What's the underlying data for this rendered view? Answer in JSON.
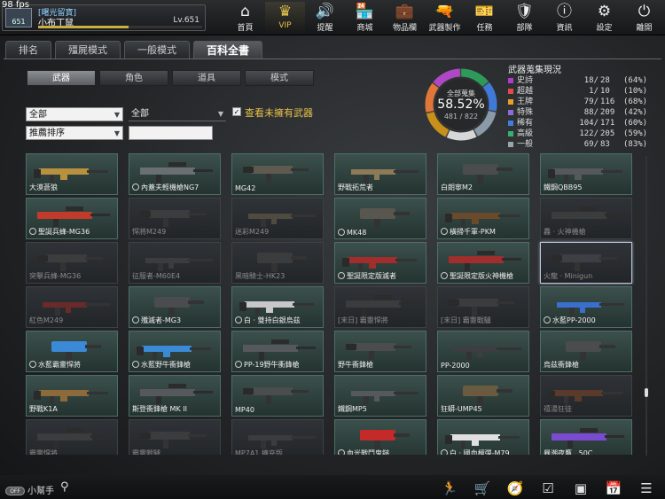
{
  "fps": "98 fps",
  "player": {
    "clan": "[曙光留寶]",
    "name": "小布丁鼠",
    "level": "Lv.651",
    "rank": "651",
    "exp_progress": 0.55
  },
  "nav": [
    {
      "label": "首頁",
      "icon": "home-icon",
      "glyph": "⌂"
    },
    {
      "label": "VIP",
      "icon": "crown-icon",
      "glyph": "♛"
    },
    {
      "label": "提醒",
      "icon": "speaker-icon",
      "glyph": "🔊"
    },
    {
      "label": "商城",
      "icon": "shop-icon",
      "glyph": "🏪"
    },
    {
      "label": "物品欄",
      "icon": "bag-icon",
      "glyph": "💼"
    },
    {
      "label": "武器製作",
      "icon": "gun-icon",
      "glyph": "🔫"
    },
    {
      "label": "任務",
      "icon": "ticket-icon",
      "glyph": "🎫"
    },
    {
      "label": "部隊",
      "icon": "shield-icon",
      "glyph": "🛡"
    },
    {
      "label": "資訊",
      "icon": "info-icon",
      "glyph": "ⓘ"
    },
    {
      "label": "設定",
      "icon": "gear-icon",
      "glyph": "⚙"
    },
    {
      "label": "離開",
      "icon": "power-icon",
      "glyph": "⏻"
    }
  ],
  "main_tabs": [
    "排名",
    "殭屍模式",
    "一般模式",
    "百科全書"
  ],
  "sub_tabs": [
    "武器",
    "角色",
    "道具",
    "模式"
  ],
  "filters": {
    "category": "全部",
    "subcategory": "全部",
    "sort": "推薦排序",
    "search": "",
    "show_unowned_label": "查看未擁有武器",
    "show_unowned_checked": true
  },
  "collection": {
    "title": "全部蒐集",
    "percent": "58.52%",
    "count": "481 / 822",
    "fraction": 0.5852,
    "ring_colors": [
      "#2e9a5a",
      "#3f7bd6",
      "#8a9aa8",
      "#d7d7d7",
      "#c8901a",
      "#e0763a",
      "#b047c4"
    ]
  },
  "stats_title": "武器蒐集現況",
  "stats": [
    {
      "name": "史詩",
      "val": "18/",
      "max": "28",
      "pct": "(64%)",
      "color": "#b13ad0"
    },
    {
      "name": "超越",
      "val": "1/",
      "max": "10",
      "pct": "(10%)",
      "color": "#e24a4a"
    },
    {
      "name": "王牌",
      "val": "79/",
      "max": "116",
      "pct": "(68%)",
      "color": "#e7a12b"
    },
    {
      "name": "特殊",
      "val": "88/",
      "max": "209",
      "pct": "(42%)",
      "color": "#8b6dd8"
    },
    {
      "name": "稀有",
      "val": "104/",
      "max": "171",
      "pct": "(60%)",
      "color": "#3c7fe0"
    },
    {
      "name": "高級",
      "val": "122/",
      "max": "205",
      "pct": "(59%)",
      "color": "#38b06a"
    },
    {
      "name": "一般",
      "val": "69/",
      "max": "83",
      "pct": "(83%)",
      "color": "#9aa4ad"
    }
  ],
  "weapons": [
    {
      "name": "大漠蒼狼",
      "owned": true,
      "badge": false,
      "color": "#b8913f"
    },
    {
      "name": "內蓋夫輕機槍NG7",
      "owned": true,
      "badge": true,
      "color": "#6a6f72"
    },
    {
      "name": "MG42",
      "owned": true,
      "badge": false,
      "color": "#5f5a50"
    },
    {
      "name": "野戰拓荒者",
      "owned": true,
      "badge": false,
      "color": "#8d7a56"
    },
    {
      "name": "白朗寧M2",
      "owned": true,
      "badge": false,
      "color": "#4a4c4e"
    },
    {
      "name": "鐵鋼QBB95",
      "owned": true,
      "badge": false,
      "color": "#55595c"
    },
    {
      "name": "聖誕兵蜂-MG36",
      "owned": true,
      "badge": true,
      "color": "#c23a2a"
    },
    {
      "name": "悍將M249",
      "owned": false,
      "badge": false,
      "color": "#3a3c3e"
    },
    {
      "name": "迷彩M249",
      "owned": false,
      "badge": false,
      "color": "#4f4b40"
    },
    {
      "name": "MK48",
      "owned": true,
      "badge": true,
      "color": "#58564f"
    },
    {
      "name": "橫掃千軍-PKM",
      "owned": true,
      "badge": true,
      "color": "#6a4a2a"
    },
    {
      "name": "轟 · 火神機槍",
      "owned": false,
      "badge": false,
      "color": "#3a3c3e"
    },
    {
      "name": "突擊兵蜂-MG36",
      "owned": false,
      "badge": false,
      "color": "#3a3c3e"
    },
    {
      "name": "征服者-M60E4",
      "owned": false,
      "badge": false,
      "color": "#3a3c3e"
    },
    {
      "name": "黑暗騎士-HK23",
      "owned": false,
      "badge": false,
      "color": "#3a3c3e"
    },
    {
      "name": "聖誕限定版滅者",
      "owned": true,
      "badge": true,
      "color": "#a12d2d"
    },
    {
      "name": "聖誕限定版火神機槍",
      "owned": true,
      "badge": true,
      "color": "#a12d2d"
    },
    {
      "name": "火龍 · Minigun",
      "owned": false,
      "badge": false,
      "color": "#3c3f44",
      "selected": true
    },
    {
      "name": "紅色M249",
      "owned": false,
      "badge": false,
      "color": "#6a2a2a"
    },
    {
      "name": "殲滅者-MG3",
      "owned": true,
      "badge": true,
      "color": "#4a4c4e"
    },
    {
      "name": "白 · 雙持白銀烏茲",
      "owned": true,
      "badge": true,
      "color": "#c8c8c8"
    },
    {
      "name": "[末日] 霸靈悍將",
      "owned": false,
      "badge": false,
      "color": "#3a3c3e"
    },
    {
      "name": "[末日] 霸靈戰驢",
      "owned": false,
      "badge": false,
      "color": "#3a3c3e"
    },
    {
      "name": "水藍PP-2000",
      "owned": true,
      "badge": true,
      "color": "#3a6fd0"
    },
    {
      "name": "水藍霸靈悍將",
      "owned": true,
      "badge": true,
      "color": "#3a8ad8"
    },
    {
      "name": "水藍野牛衝鋒槍",
      "owned": true,
      "badge": true,
      "color": "#3a8ad8"
    },
    {
      "name": "PP-19野牛衝鋒槍",
      "owned": true,
      "badge": true,
      "color": "#55595c"
    },
    {
      "name": "野牛衝鋒槍",
      "owned": true,
      "badge": false,
      "color": "#4a4c4e"
    },
    {
      "name": "PP-2000",
      "owned": true,
      "badge": false,
      "color": "#3c3e40"
    },
    {
      "name": "烏茲衝鋒槍",
      "owned": true,
      "badge": false,
      "color": "#4a4c4e"
    },
    {
      "name": "野戰K1A",
      "owned": true,
      "badge": false,
      "color": "#8d6a3a"
    },
    {
      "name": "斯登衝鋒槍 MK II",
      "owned": true,
      "badge": false,
      "color": "#55595c"
    },
    {
      "name": "MP40",
      "owned": true,
      "badge": false,
      "color": "#4a4c4e"
    },
    {
      "name": "鐵鋼MP5",
      "owned": true,
      "badge": false,
      "color": "#55595c"
    },
    {
      "name": "狂蟒-UMP45",
      "owned": true,
      "badge": false,
      "color": "#6a5a40"
    },
    {
      "name": "禧湯狂徒",
      "owned": false,
      "badge": false,
      "color": "#5a3a2a"
    },
    {
      "name": "霸靈悍將",
      "owned": false,
      "badge": false,
      "color": "#3a3c3e"
    },
    {
      "name": "霸靈戰驢",
      "owned": false,
      "badge": false,
      "color": "#3a3c3e"
    },
    {
      "name": "MP7A1 擴充版",
      "owned": false,
      "badge": false,
      "color": "#3a3c3e"
    },
    {
      "name": "血光戰鬥鬼鎚",
      "owned": true,
      "badge": true,
      "color": "#c42a2a"
    },
    {
      "name": "白 · 國血榴彈-M79",
      "owned": true,
      "badge": true,
      "color": "#e0e0e0"
    },
    {
      "name": "暴潮夜鷹 . 50C",
      "owned": true,
      "badge": false,
      "color": "#7a4ad0"
    }
  ],
  "helper": {
    "toggle": "OFF",
    "label": "小幫手"
  },
  "bottom_icons": [
    "runner-icon",
    "cart-icon",
    "compass-icon",
    "checklist-icon",
    "book-icon",
    "calendar-icon",
    "menu-icon"
  ]
}
